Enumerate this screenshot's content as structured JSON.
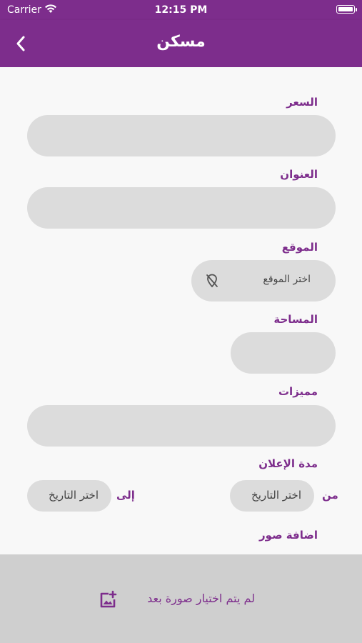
{
  "status_bar": {
    "carrier": "Carrier",
    "time": "12:15 PM"
  },
  "app_bar": {
    "title": "مسكن"
  },
  "form": {
    "price_label": "السعر",
    "address_label": "العنوان",
    "location_label": "الموقع",
    "location_placeholder": "اختر الموقع",
    "area_label": "المساحة",
    "features_label": "مميزات",
    "duration_label": "مدة الإعلان",
    "from_label": "من",
    "to_label": "إلى",
    "from_date_placeholder": "اختر التاريخ",
    "to_date_placeholder": "اختر التاريخ",
    "add_images_label": "اضافة صور"
  },
  "images": {
    "empty_message": "لم يتم اختيار صورة بعد"
  },
  "colors": {
    "accent": "#7d2d8c",
    "field": "#dcdcdc",
    "footer": "#cfcfcf"
  },
  "icons": [
    "wifi-icon",
    "battery-icon",
    "back-chevron-icon",
    "location-off-icon",
    "add-photo-icon"
  ]
}
